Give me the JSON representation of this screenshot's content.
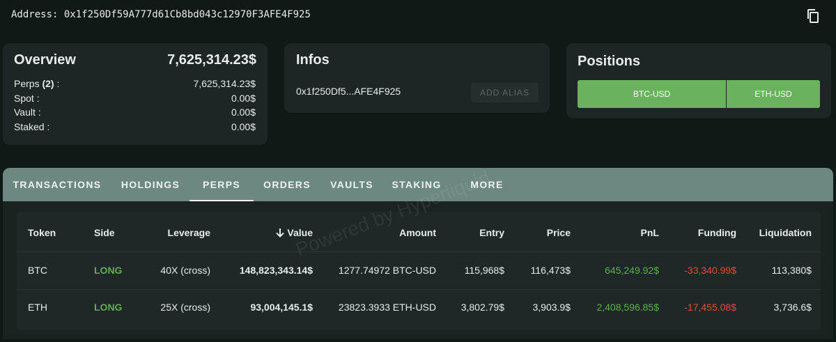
{
  "address": {
    "label": "Address:",
    "value": "0x1f250Df59A777d61Cb8bd043c12970F3AFE4F925",
    "copy_icon": "copy-icon"
  },
  "overview": {
    "title": "Overview",
    "total": "7,625,314.23$",
    "rows": [
      {
        "label_main": "Perps",
        "label_count": "(2)",
        "label_suffix": " :",
        "value": "7,625,314.23$"
      },
      {
        "label": "Spot :",
        "value": "0.00$"
      },
      {
        "label": "Vault :",
        "value": "0.00$"
      },
      {
        "label": "Staked :",
        "value": "0.00$"
      }
    ]
  },
  "infos": {
    "title": "Infos",
    "short_address": "0x1f250Df5...AFE4F925",
    "add_alias_label": "ADD ALIAS"
  },
  "positions": {
    "title": "Positions",
    "buttons": [
      "BTC-USD",
      "ETH-USD"
    ],
    "button_color": "#6bb25e"
  },
  "tabs": [
    "TRANSACTIONS",
    "HOLDINGS",
    "PERPS",
    "ORDERS",
    "VAULTS",
    "STAKING",
    "MORE"
  ],
  "active_tab": "PERPS",
  "table": {
    "headers": [
      "Token",
      "Side",
      "Leverage",
      "Value",
      "Amount",
      "Entry",
      "Price",
      "PnL",
      "Funding",
      "Liquidation"
    ],
    "sort_icon": "arrow-down-icon",
    "rows": [
      {
        "token": "BTC",
        "side": "LONG",
        "leverage": "40X (cross)",
        "value": "148,823,343.14$",
        "amount": "1277.74972 BTC-USD",
        "entry": "115,968$",
        "price": "116,473$",
        "pnl": "645,249.92$",
        "funding": "-33,340.99$",
        "liquidation": "113,380$"
      },
      {
        "token": "ETH",
        "side": "LONG",
        "leverage": "25X (cross)",
        "value": "93,004,145.1$",
        "amount": "23823.3933 ETH-USD",
        "entry": "3,802.79$",
        "price": "3,903.9$",
        "pnl": "2,408,596.85$",
        "funding": "-17,455.08$",
        "liquidation": "3,736.6$"
      }
    ]
  },
  "watermark": "Powered by Hyperliquid",
  "colors": {
    "positive": "#5fb04f",
    "negative": "#e64b3c",
    "tab_bar": "#6d8880"
  }
}
